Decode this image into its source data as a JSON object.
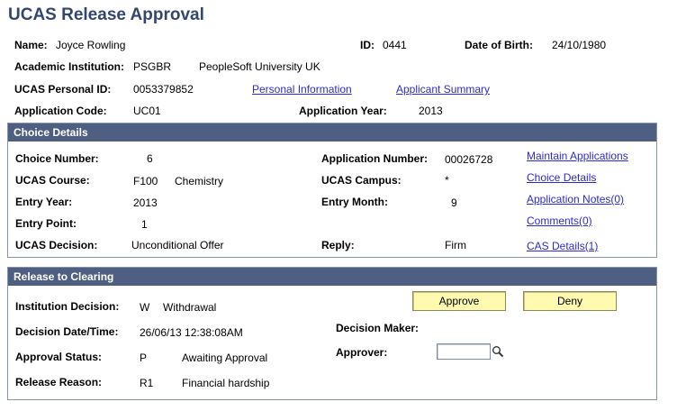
{
  "page": {
    "title": "UCAS Release Approval"
  },
  "header": {
    "name_label": "Name:",
    "name": "Joyce Rowling",
    "id_label": "ID:",
    "id": "0441",
    "dob_label": "Date of Birth:",
    "dob": "24/10/1980",
    "institution_label": "Academic Institution:",
    "institution_code": "PSGBR",
    "institution_name": "PeopleSoft University UK",
    "personal_id_label": "UCAS Personal ID:",
    "personal_id": "0053379852",
    "personal_info_link": "Personal Information",
    "applicant_summary_link": "Applicant Summary",
    "app_code_label": "Application Code:",
    "app_code": "UC01",
    "app_year_label": "Application Year:",
    "app_year": "2013"
  },
  "choice": {
    "heading": "Choice Details",
    "choice_number_label": "Choice Number:",
    "choice_number": "6",
    "app_number_label": "Application Number:",
    "app_number": "00026728",
    "course_label": "UCAS Course:",
    "course_code": "F100",
    "course_name": "Chemistry",
    "campus_label": "UCAS Campus:",
    "campus": "*",
    "entry_year_label": "Entry Year:",
    "entry_year": "2013",
    "entry_month_label": "Entry Month:",
    "entry_month": "9",
    "entry_point_label": "Entry Point:",
    "entry_point": "1",
    "decision_label": "UCAS Decision:",
    "decision": "Unconditional Offer",
    "reply_label": "Reply:",
    "reply": "Firm",
    "links": {
      "maintain": "Maintain Applications",
      "details": "Choice Details",
      "notes": "Application Notes(0)",
      "comments": "Comments(0)",
      "cas": "CAS Details(1)"
    }
  },
  "release": {
    "heading": "Release to Clearing",
    "inst_decision_label": "Institution Decision:",
    "inst_decision_code": "W",
    "inst_decision": "Withdrawal",
    "decision_dt_label": "Decision Date/Time:",
    "decision_dt": "26/06/13 12:38:08AM",
    "approval_status_label": "Approval Status:",
    "approval_status_code": "P",
    "approval_status": "Awaiting Approval",
    "release_reason_label": "Release Reason:",
    "release_reason_code": "R1",
    "release_reason": "Financial hardship",
    "decision_maker_label": "Decision Maker:",
    "approver_label": "Approver:",
    "approver_value": "",
    "approve_button": "Approve",
    "deny_button": "Deny"
  },
  "colors": {
    "title": "#34466e",
    "section_header": "#4f5f82",
    "button": "#fffab0",
    "link": "#2b2bcc"
  }
}
